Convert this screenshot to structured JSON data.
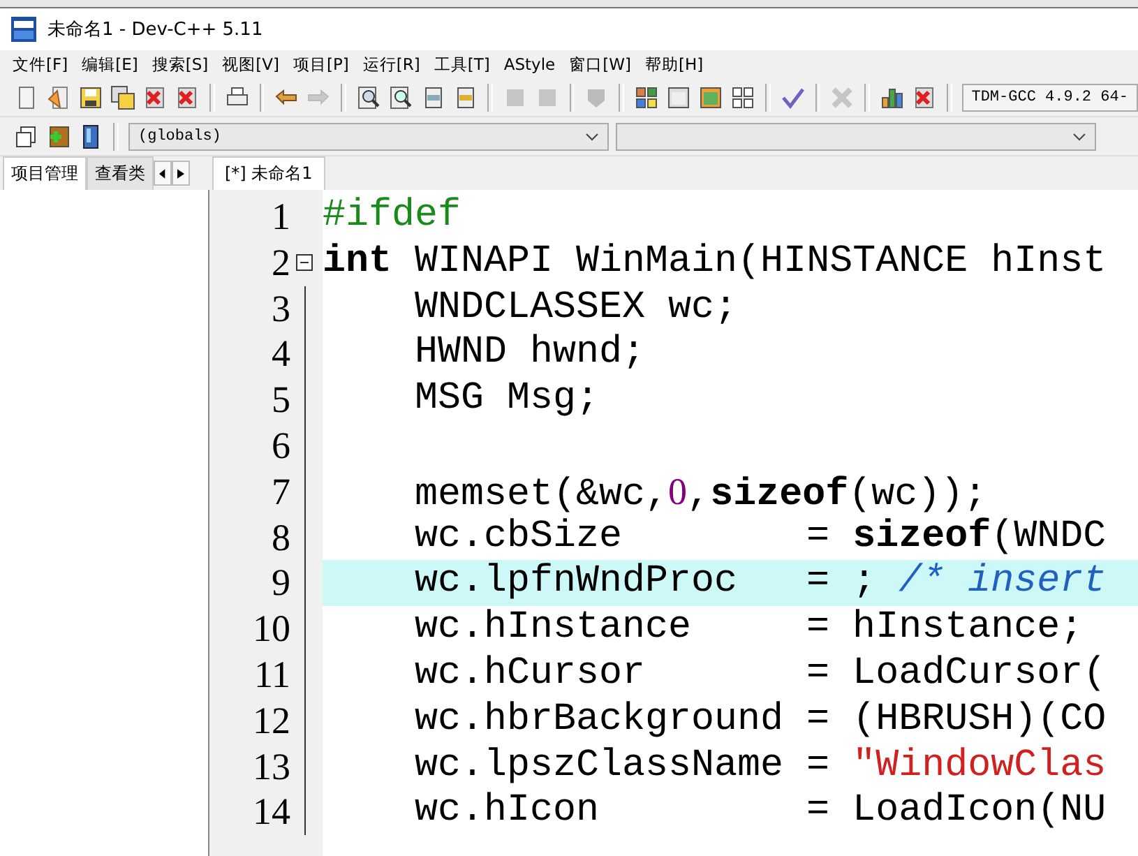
{
  "window": {
    "title": "未命名1 - Dev-C++ 5.11"
  },
  "menu": [
    {
      "label": "文件[F]"
    },
    {
      "label": "编辑[E]"
    },
    {
      "label": "搜索[S]"
    },
    {
      "label": "视图[V]"
    },
    {
      "label": "项目[P]"
    },
    {
      "label": "运行[R]"
    },
    {
      "label": "工具[T]"
    },
    {
      "label": "AStyle"
    },
    {
      "label": "窗口[W]"
    },
    {
      "label": "帮助[H]"
    }
  ],
  "toolbar_groups": [
    [
      {
        "kind": "new",
        "disabled": false
      },
      {
        "kind": "open",
        "disabled": false
      },
      {
        "kind": "save",
        "disabled": false
      },
      {
        "kind": "save-all",
        "disabled": false
      },
      {
        "kind": "close",
        "disabled": false
      },
      {
        "kind": "close-all",
        "disabled": false
      }
    ],
    [
      {
        "kind": "print",
        "disabled": false
      }
    ],
    [
      {
        "kind": "undo",
        "disabled": false
      },
      {
        "kind": "redo",
        "disabled": true
      }
    ],
    [
      {
        "kind": "find",
        "disabled": false
      },
      {
        "kind": "find-next",
        "disabled": false
      },
      {
        "kind": "goto",
        "disabled": false
      },
      {
        "kind": "insert",
        "disabled": false
      }
    ],
    [
      {
        "kind": "back",
        "disabled": true
      },
      {
        "kind": "forward",
        "disabled": true
      }
    ],
    [
      {
        "kind": "shield",
        "disabled": true
      }
    ],
    [
      {
        "kind": "grid-color",
        "disabled": false
      },
      {
        "kind": "window",
        "disabled": false
      },
      {
        "kind": "window-color",
        "disabled": false
      },
      {
        "kind": "grid",
        "disabled": false
      }
    ],
    [
      {
        "kind": "check",
        "disabled": false
      }
    ],
    [
      {
        "kind": "cross",
        "disabled": true
      }
    ],
    [
      {
        "kind": "chart",
        "disabled": false
      },
      {
        "kind": "chart-cross",
        "disabled": false
      }
    ]
  ],
  "compiler": {
    "value": "TDM-GCC 4.9.2 64-"
  },
  "toolbar2": [
    {
      "kind": "pages",
      "disabled": false
    },
    {
      "kind": "add",
      "disabled": false
    },
    {
      "kind": "book",
      "disabled": false
    }
  ],
  "scope_dropdown": {
    "value": "(globals)"
  },
  "left_panel": {
    "tabs": [
      {
        "label": "项目管理",
        "selected": true
      },
      {
        "label": "查看类",
        "selected": false
      }
    ]
  },
  "editor": {
    "tabs": [
      {
        "label": "[*] 未命名1",
        "selected": true
      }
    ],
    "lines": [
      {
        "number": "1",
        "fold_start": false,
        "highlighted": false,
        "tokens": [
          {
            "kind": "preproc",
            "text": "#ifdef"
          }
        ]
      },
      {
        "number": "2",
        "fold_start": true,
        "highlighted": false,
        "tokens": [
          {
            "kind": "keyword",
            "text": "int"
          },
          {
            "kind": "plain",
            "text": " WINAPI WinMain(HINSTANCE hInst"
          }
        ]
      },
      {
        "number": "3",
        "fold_start": false,
        "highlighted": false,
        "tokens": [
          {
            "kind": "plain",
            "text": "    WNDCLASSEX wc;"
          }
        ]
      },
      {
        "number": "4",
        "fold_start": false,
        "highlighted": false,
        "tokens": [
          {
            "kind": "plain",
            "text": "    HWND hwnd;"
          }
        ]
      },
      {
        "number": "5",
        "fold_start": false,
        "highlighted": false,
        "tokens": [
          {
            "kind": "plain",
            "text": "    MSG Msg;"
          }
        ]
      },
      {
        "number": "6",
        "fold_start": false,
        "highlighted": false
      },
      {
        "number": "7",
        "fold_start": false,
        "highlighted": false,
        "tokens": [
          {
            "kind": "plain",
            "text": "    memset(&wc,"
          },
          {
            "kind": "number",
            "text": "0"
          },
          {
            "kind": "plain",
            "text": ","
          },
          {
            "kind": "keyword",
            "text": "sizeof"
          },
          {
            "kind": "plain",
            "text": "(wc));"
          }
        ]
      },
      {
        "number": "8",
        "fold_start": false,
        "highlighted": false,
        "tokens": [
          {
            "kind": "plain",
            "text": "    wc.cbSize        = "
          },
          {
            "kind": "keyword",
            "text": "sizeof"
          },
          {
            "kind": "plain",
            "text": "(WNDC"
          }
        ]
      },
      {
        "number": "9",
        "fold_start": false,
        "highlighted": true,
        "tokens": [
          {
            "kind": "plain",
            "text": "    wc.lpfnWndProc   = "
          },
          {
            "kind": "plain",
            "text": ";"
          },
          {
            "kind": "comment",
            "text": " /* insert"
          }
        ]
      },
      {
        "number": "10",
        "fold_start": false,
        "highlighted": false,
        "tokens": [
          {
            "kind": "plain",
            "text": "    wc.hInstance     = hInstance;"
          }
        ]
      },
      {
        "number": "11",
        "fold_start": false,
        "highlighted": false,
        "tokens": [
          {
            "kind": "plain",
            "text": "    wc.hCursor       = LoadCursor("
          }
        ]
      },
      {
        "number": "12",
        "fold_start": false,
        "highlighted": false,
        "tokens": [
          {
            "kind": "plain",
            "text": "    wc.hbrBackground = (HBRUSH)(CO"
          }
        ]
      },
      {
        "number": "13",
        "fold_start": false,
        "highlighted": false,
        "tokens": [
          {
            "kind": "plain",
            "text": "    wc.lpszClassName = "
          },
          {
            "kind": "string",
            "text": "\"WindowClas"
          }
        ]
      },
      {
        "number": "14",
        "fold_start": false,
        "highlighted": false,
        "tokens": [
          {
            "kind": "plain",
            "text": "    wc.hIcon         = LoadIcon(NU"
          }
        ]
      }
    ]
  }
}
